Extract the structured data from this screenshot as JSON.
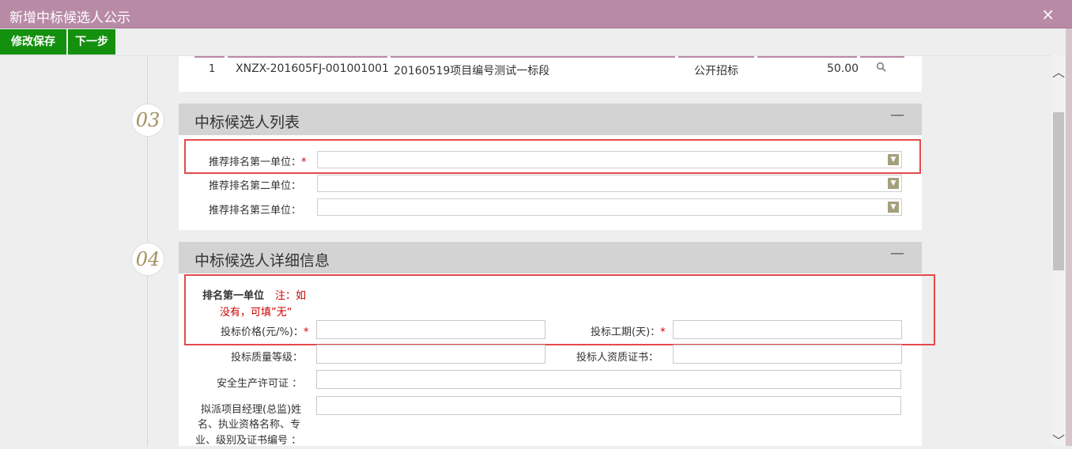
{
  "window": {
    "title": "新增中标候选人公示",
    "close": "×"
  },
  "toolbar": {
    "save_label": "修改保存",
    "next_label": "下一步"
  },
  "project_table": {
    "row": {
      "index": "1",
      "code": "XNZX-201605FJ-001001001",
      "name": "20160519项目编号测试一标段",
      "method": "公开招标",
      "amount": "50.00"
    },
    "search_icon": "search-icon"
  },
  "section3": {
    "number": "03",
    "title": "中标候选人列表",
    "collapse": "—",
    "first_label": "推荐排名第一单位：",
    "second_label": "推荐排名第二单位：",
    "third_label": "推荐排名第三单位：",
    "required_mark": "*",
    "dropdown_icon": "chevron-down-icon"
  },
  "section4": {
    "number": "04",
    "title": "中标候选人详细信息",
    "collapse": "—",
    "rank_title": "排名第一单位",
    "note_line1": "注：如",
    "note_line2": "没有，可填”无“",
    "price_label": "投标价格(元/%)：",
    "period_label": "投标工期(天)：",
    "quality_label": "投标质量等级：",
    "cert_label": "投标人资质证书：",
    "safety_label": "安全生产许可证 ：",
    "manager_label_line1": "拟派项目经理(总监)姓",
    "manager_label_line2": "名、执业资格名称、专",
    "manager_label_line3": "业、级别及证书编号 ：",
    "required_mark": "*"
  },
  "scrollbar": {
    "up": "︿",
    "down": "﹀"
  },
  "colors": {
    "title_bar": "#b98aa6",
    "button_green": "#14900f",
    "highlight_red": "#e34a4a",
    "number_gold": "#a3915f"
  }
}
